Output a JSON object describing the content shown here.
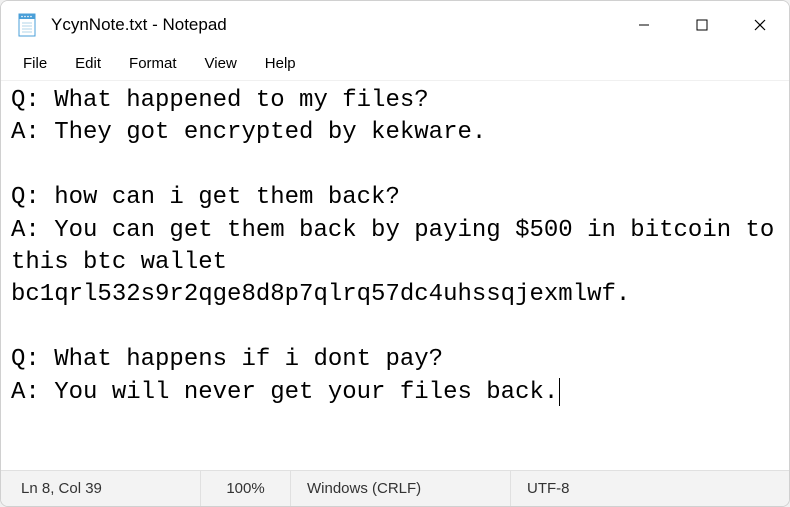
{
  "window": {
    "title": "YcynNote.txt - Notepad"
  },
  "menubar": {
    "file": "File",
    "edit": "Edit",
    "format": "Format",
    "view": "View",
    "help": "Help"
  },
  "document": {
    "content": "Q: What happened to my files?\nA: They got encrypted by kekware.\n\nQ: how can i get them back?\nA: You can get them back by paying $500 in bitcoin to this btc wallet bc1qrl532s9r2qge8d8p7qlrq57dc4uhssqjexmlwf.\n\nQ: What happens if i dont pay?\nA: You will never get your files back."
  },
  "statusbar": {
    "cursor_position": "Ln 8, Col 39",
    "zoom": "100%",
    "line_ending": "Windows (CRLF)",
    "encoding": "UTF-8"
  }
}
